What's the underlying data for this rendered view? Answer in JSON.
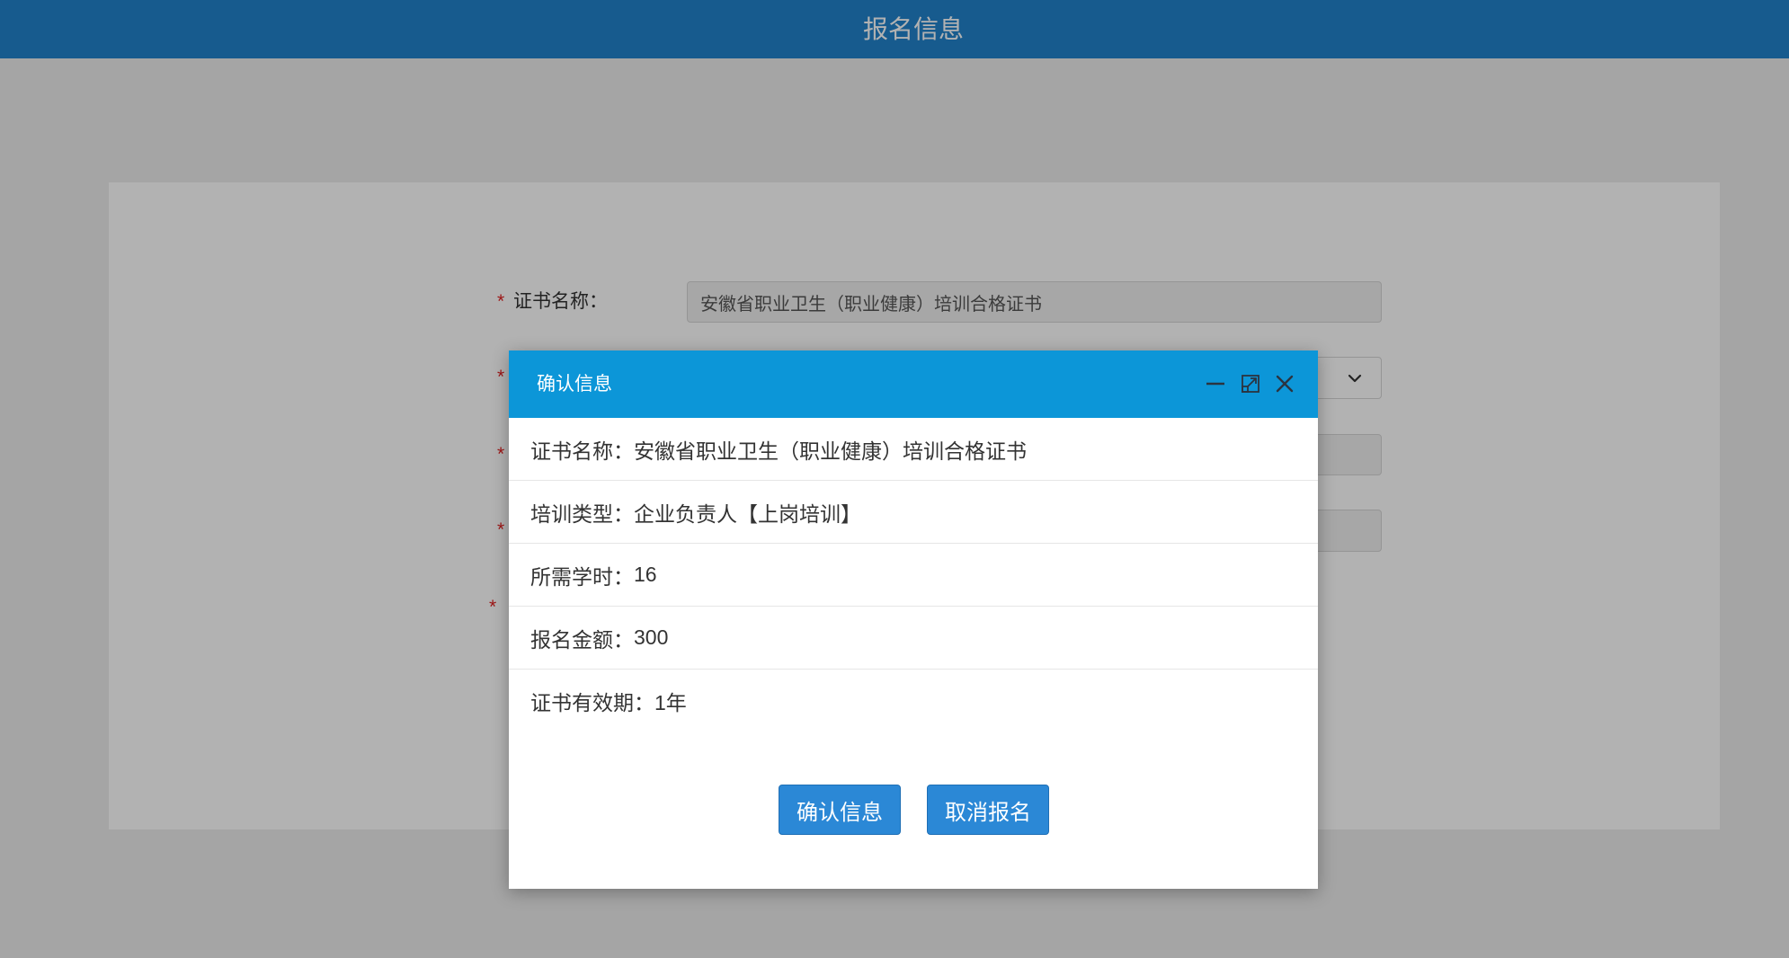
{
  "header": {
    "title": "报名信息"
  },
  "form": {
    "required_mark": "*",
    "fields": [
      {
        "label": "证书名称：",
        "value": "安徽省职业卫生（职业健康）培训合格证书"
      }
    ]
  },
  "dialog": {
    "title": "确认信息",
    "rows": [
      {
        "label": "证书名称：",
        "value": "安徽省职业卫生（职业健康）培训合格证书"
      },
      {
        "label": "培训类型：",
        "value": "企业负责人【上岗培训】"
      },
      {
        "label": "所需学时：",
        "value": "16"
      },
      {
        "label": "报名金额：",
        "value": "300"
      },
      {
        "label": "证书有效期：",
        "value": "1年"
      }
    ],
    "confirm_label": "确认信息",
    "cancel_label": "取消报名"
  },
  "icons": {
    "minimize": "minimize-icon",
    "maximize": "maximize-icon",
    "close": "close-icon",
    "select_arrow": "chevron-down-icon"
  },
  "colors": {
    "header_bg": "#2283cc",
    "dialog_titlebar": "#0c96d8",
    "button_bg": "#2b88d6",
    "required_mark": "#e02020",
    "overlay": "rgba(0,0,0,0.3)"
  }
}
